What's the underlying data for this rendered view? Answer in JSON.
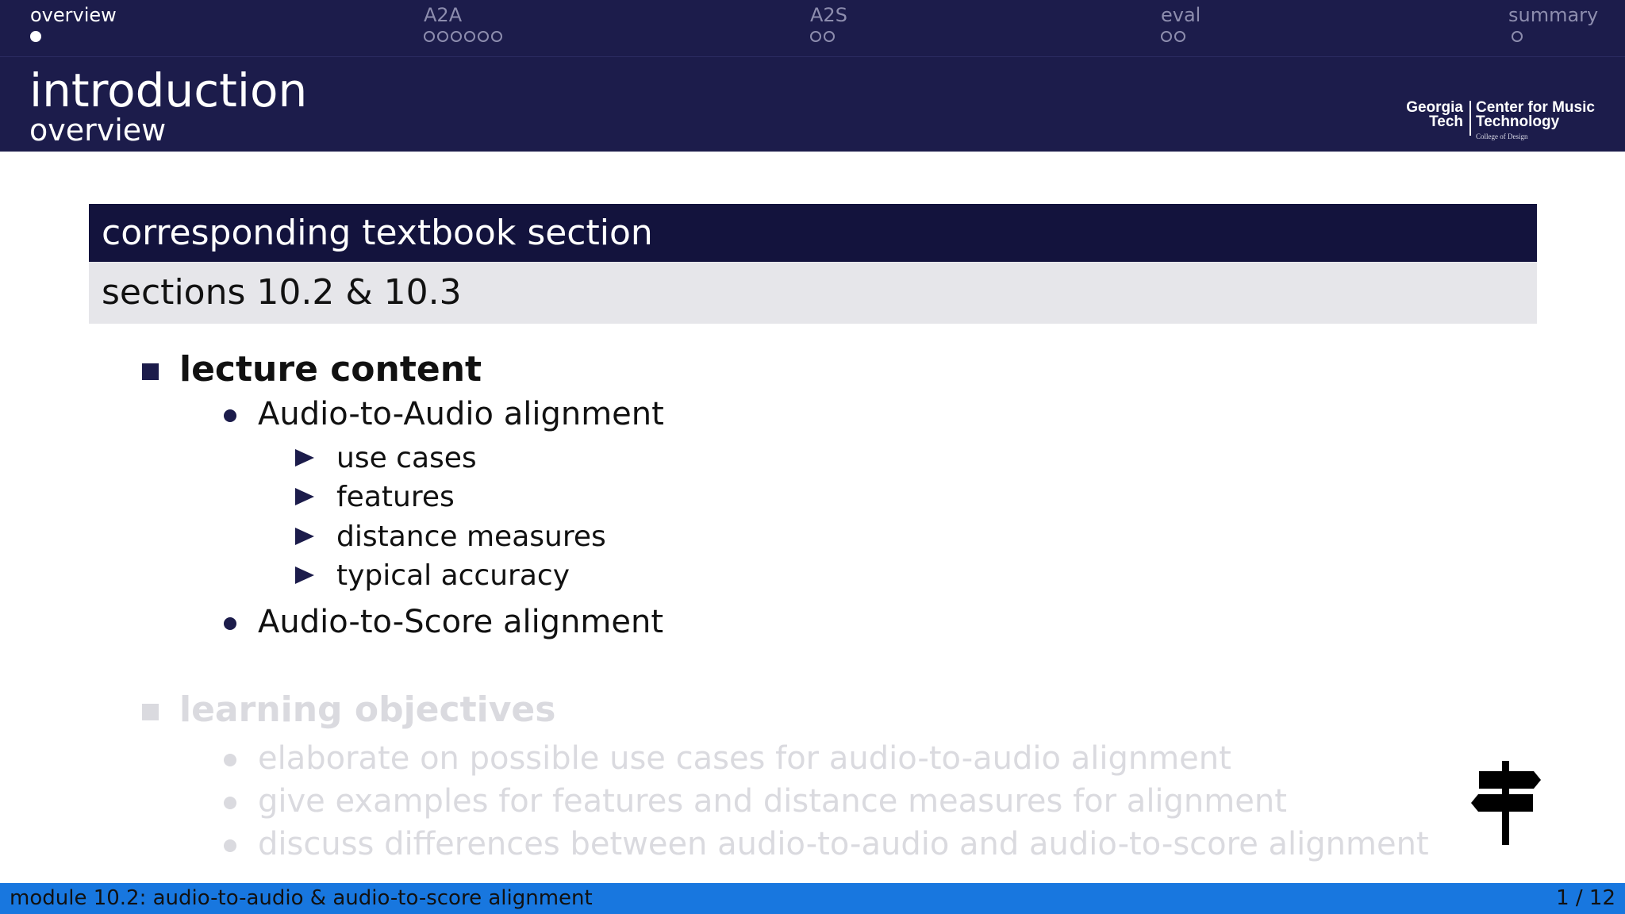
{
  "nav": {
    "sections": [
      {
        "label": "overview",
        "dots": 1,
        "filled": 1,
        "active": true
      },
      {
        "label": "A2A",
        "dots": 6,
        "filled": 0,
        "active": false
      },
      {
        "label": "A2S",
        "dots": 2,
        "filled": 0,
        "active": false
      },
      {
        "label": "eval",
        "dots": 2,
        "filled": 0,
        "active": false
      },
      {
        "label": "summary",
        "dots": 1,
        "filled": 0,
        "active": false
      }
    ]
  },
  "frame": {
    "title": "introduction",
    "subtitle": "overview"
  },
  "logo": {
    "line1": "Georgia",
    "line2": "Tech",
    "center_line1": "Center for Music",
    "center_line2": "Technology",
    "college": "College of Design"
  },
  "block": {
    "title": "corresponding textbook section",
    "body": "sections 10.2 & 10.3"
  },
  "lecture": {
    "heading": "lecture content",
    "items": [
      {
        "label": "Audio-to-Audio alignment",
        "subitems": [
          "use cases",
          "features",
          "distance measures",
          "typical accuracy"
        ]
      },
      {
        "label": "Audio-to-Score alignment",
        "subitems": []
      }
    ]
  },
  "objectives": {
    "heading": "learning objectives",
    "items": [
      "elaborate on possible use cases for audio-to-audio alignment",
      "give examples for features and distance measures for alignment",
      "discuss differences between audio-to-audio and audio-to-score alignment"
    ]
  },
  "footer": {
    "module": "module 10.2: audio-to-audio & audio-to-score alignment",
    "page": "1 / 12"
  },
  "colors": {
    "navy": "#1c1c4b",
    "block_title_bg": "#13133d",
    "block_body_bg": "#e6e6ea",
    "footer_blue": "#1877df",
    "dimmed_text": "#dadadf"
  },
  "icons": {
    "signpost": "signpost-icon"
  }
}
